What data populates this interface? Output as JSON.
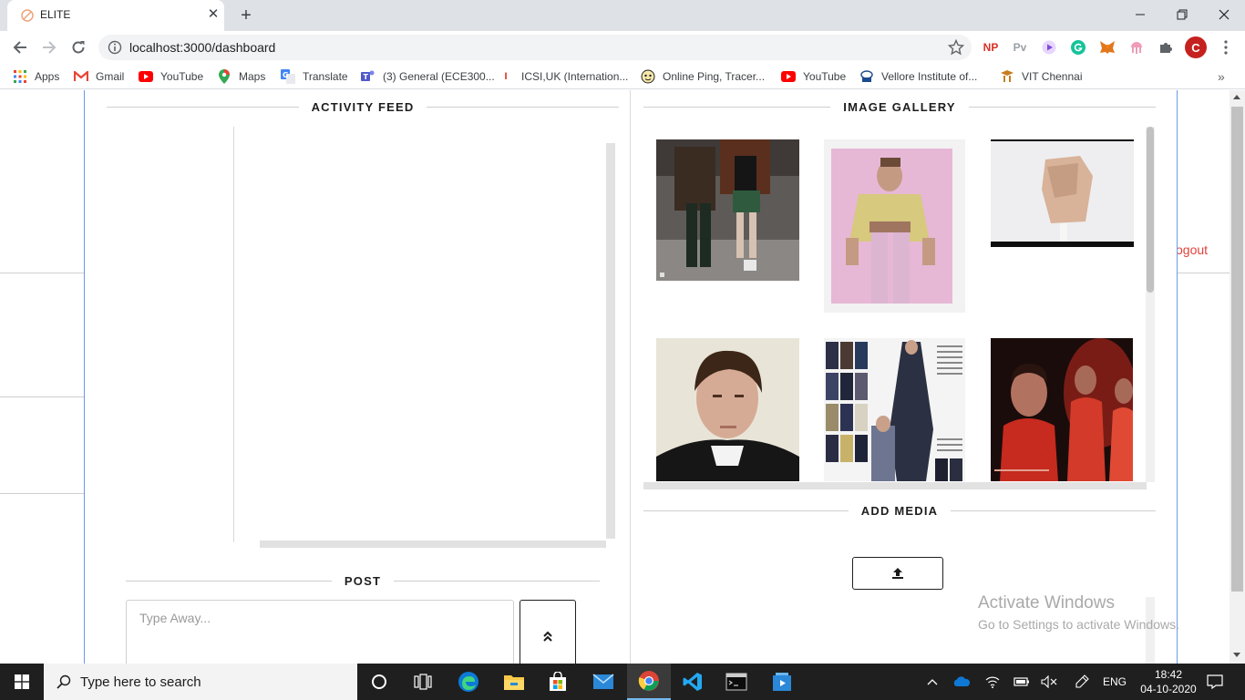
{
  "browser": {
    "tab_title": "ELITE",
    "url": "localhost:3000/dashboard",
    "bookmarks": [
      {
        "label": "Apps",
        "icon": "apps-grid-icon"
      },
      {
        "label": "Gmail",
        "icon": "gmail-icon"
      },
      {
        "label": "YouTube",
        "icon": "youtube-icon"
      },
      {
        "label": "Maps",
        "icon": "maps-pin-icon"
      },
      {
        "label": "Translate",
        "icon": "translate-icon"
      },
      {
        "label": "(3) General (ECE300...",
        "icon": "teams-icon"
      },
      {
        "label": "ICSI,UK (Internation...",
        "icon": "icsi-icon"
      },
      {
        "label": "Online Ping, Tracer...",
        "icon": "ping-icon"
      },
      {
        "label": "YouTube",
        "icon": "youtube-icon"
      },
      {
        "label": "Vellore Institute of...",
        "icon": "vit-icon"
      },
      {
        "label": "VIT Chennai",
        "icon": "vit-chennai-icon"
      }
    ],
    "extensions": [
      "NP",
      "Pv"
    ],
    "profile_initial": "C"
  },
  "page": {
    "logout": "ogout",
    "activity_feed_title": "ACTIVITY FEED",
    "image_gallery_title": "IMAGE GALLERY",
    "add_media_title": "ADD MEDIA",
    "post_title": "POST",
    "post_placeholder": "Type Away..."
  },
  "watermark": {
    "line1": "Activate Windows",
    "line2": "Go to Settings to activate Windows."
  },
  "taskbar": {
    "search_placeholder": "Type here to search",
    "language": "ENG",
    "time": "18:42",
    "date": "04-10-2020"
  }
}
